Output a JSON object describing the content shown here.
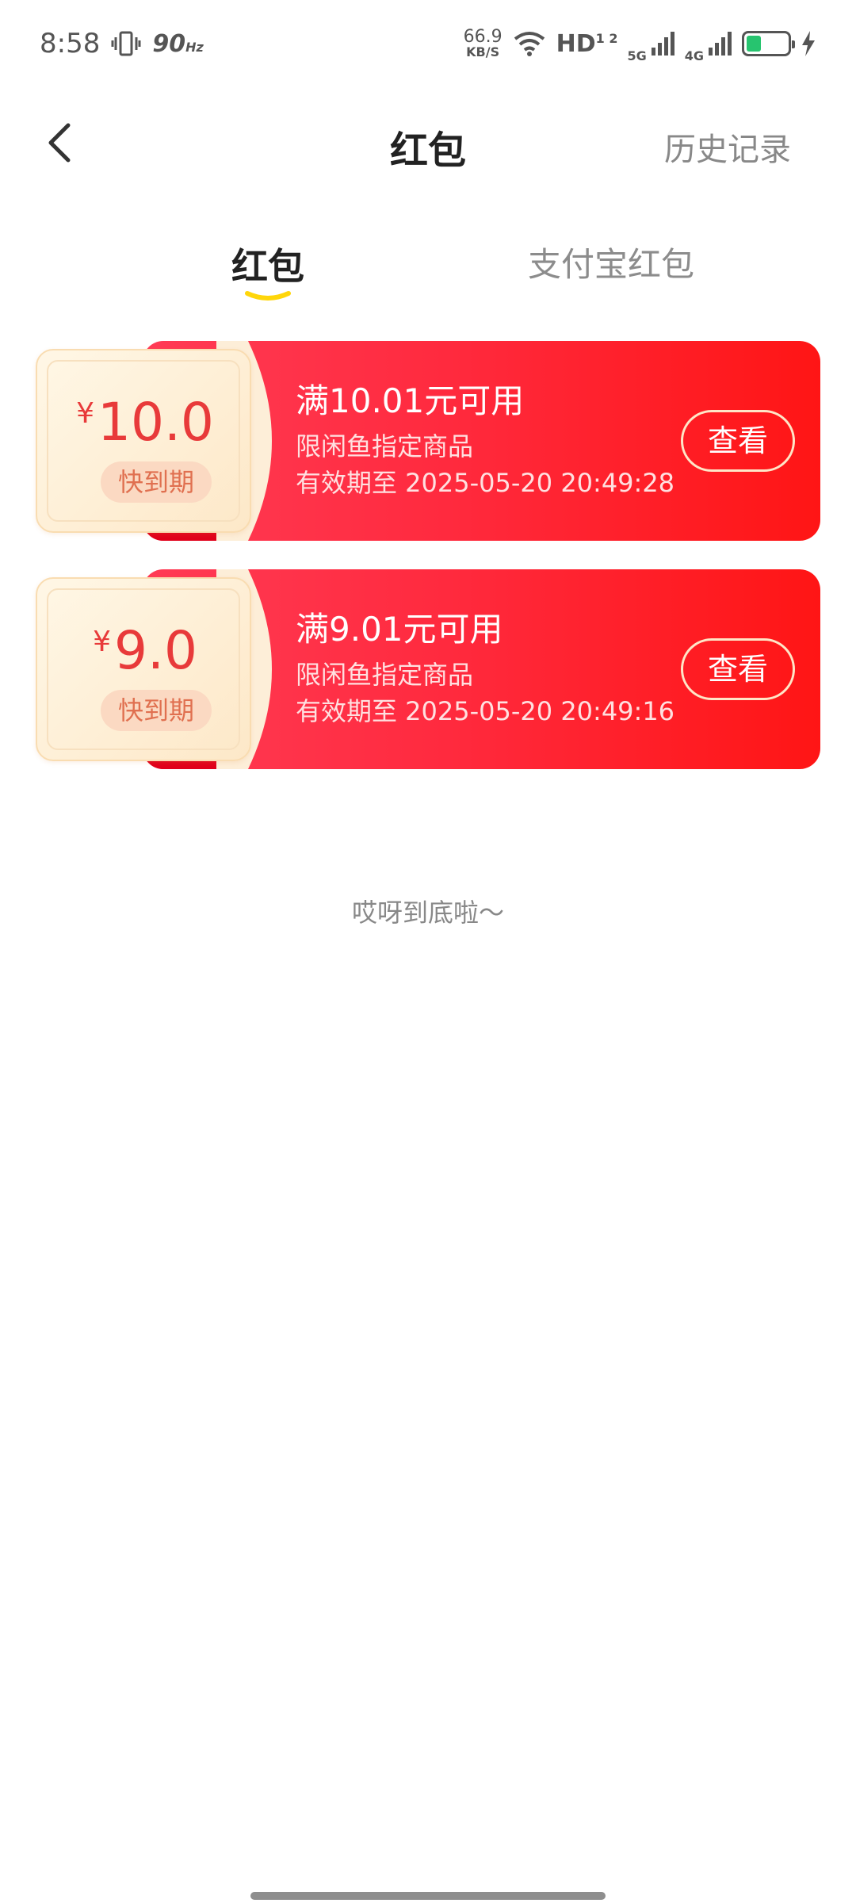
{
  "status_bar": {
    "time": "8:58",
    "refresh_rate": "90",
    "refresh_unit": "Hz",
    "net_speed_value": "66.9",
    "net_speed_unit": "KB/S",
    "hd_label": "HD",
    "hd_sub": "1 2",
    "net1": "5G",
    "net2": "4G",
    "battery_color": "#27c46f"
  },
  "header": {
    "back_icon": "chevron-left-icon",
    "title": "红包",
    "history_label": "历史记录"
  },
  "tabs": {
    "active_label": "红包",
    "alipay_label": "支付宝红包",
    "underline_color": "#ffd60a"
  },
  "coupons": [
    {
      "currency": "¥",
      "amount": "10.0",
      "badge": "快到期",
      "title": "满10.01元可用",
      "scope": "限闲鱼指定商品",
      "expiry": "有效期至 2025-05-20 20:49:28",
      "button": "查看"
    },
    {
      "currency": "¥",
      "amount": "9.0",
      "badge": "快到期",
      "title": "满9.01元可用",
      "scope": "限闲鱼指定商品",
      "expiry": "有效期至 2025-05-20 20:49:16",
      "button": "查看"
    }
  ],
  "end_text": "哎呀到底啦～",
  "colors": {
    "coupon_red": "#ff1e2e",
    "amount_red": "#e83a3a",
    "stub_cream": "#fdf0d8"
  }
}
